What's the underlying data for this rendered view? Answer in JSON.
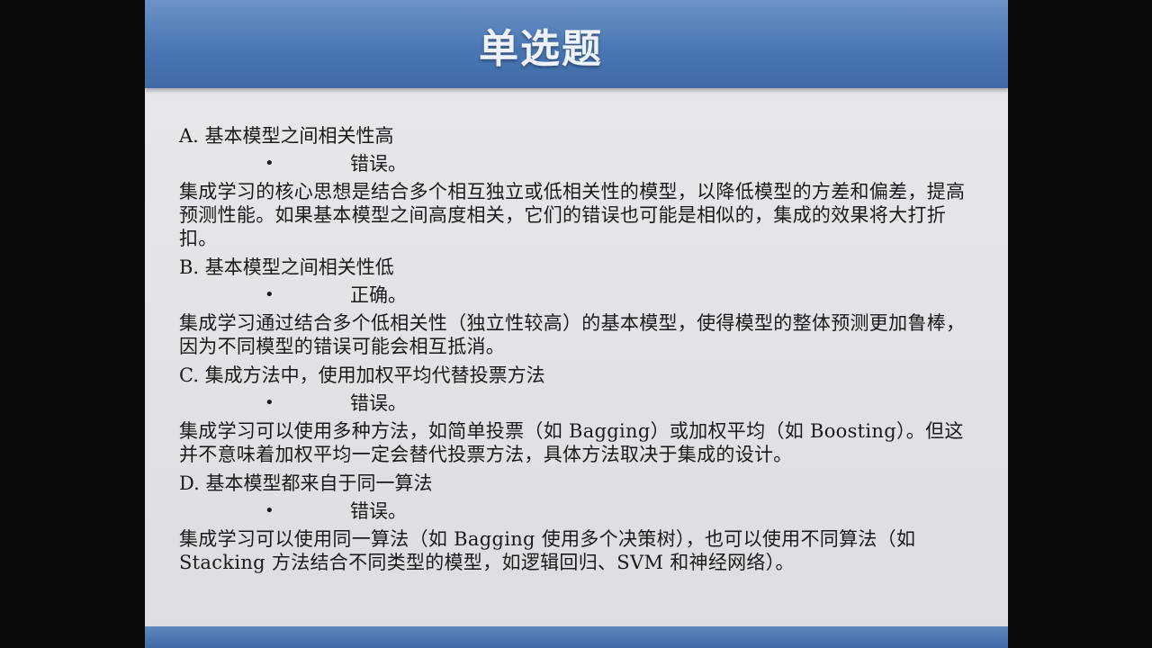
{
  "slide": {
    "title": "单选题",
    "options": [
      {
        "title": "A. 基本模型之间相关性高",
        "verdict": "错误。",
        "explanation": "集成学习的核心思想是结合多个相互独立或低相关性的模型，以降低模型的方差和偏差，提高预测性能。如果基本模型之间高度相关，它们的错误也可能是相似的，集成的效果将大打折扣。"
      },
      {
        "title": "B. 基本模型之间相关性低",
        "verdict": "正确。",
        "explanation": "集成学习通过结合多个低相关性（独立性较高）的基本模型，使得模型的整体预测更加鲁棒，因为不同模型的错误可能会相互抵消。"
      },
      {
        "title": "C. 集成方法中，使用加权平均代替投票方法",
        "verdict": "错误。",
        "explanation": "集成学习可以使用多种方法，如简单投票（如 Bagging）或加权平均（如 Boosting）。但这并不意味着加权平均一定会替代投票方法，具体方法取决于集成的设计。"
      },
      {
        "title": "D. 基本模型都来自于同一算法",
        "verdict": "错误。",
        "explanation": "集成学习可以使用同一算法（如 Bagging 使用多个决策树），也可以使用不同算法（如 Stacking 方法结合不同类型的模型，如逻辑回归、SVM 和神经网络）。"
      }
    ],
    "bullet_glyph": "•"
  },
  "colors": {
    "header": "#4a77b4",
    "background": "#e2e3e7",
    "text": "#1a1a1a"
  }
}
